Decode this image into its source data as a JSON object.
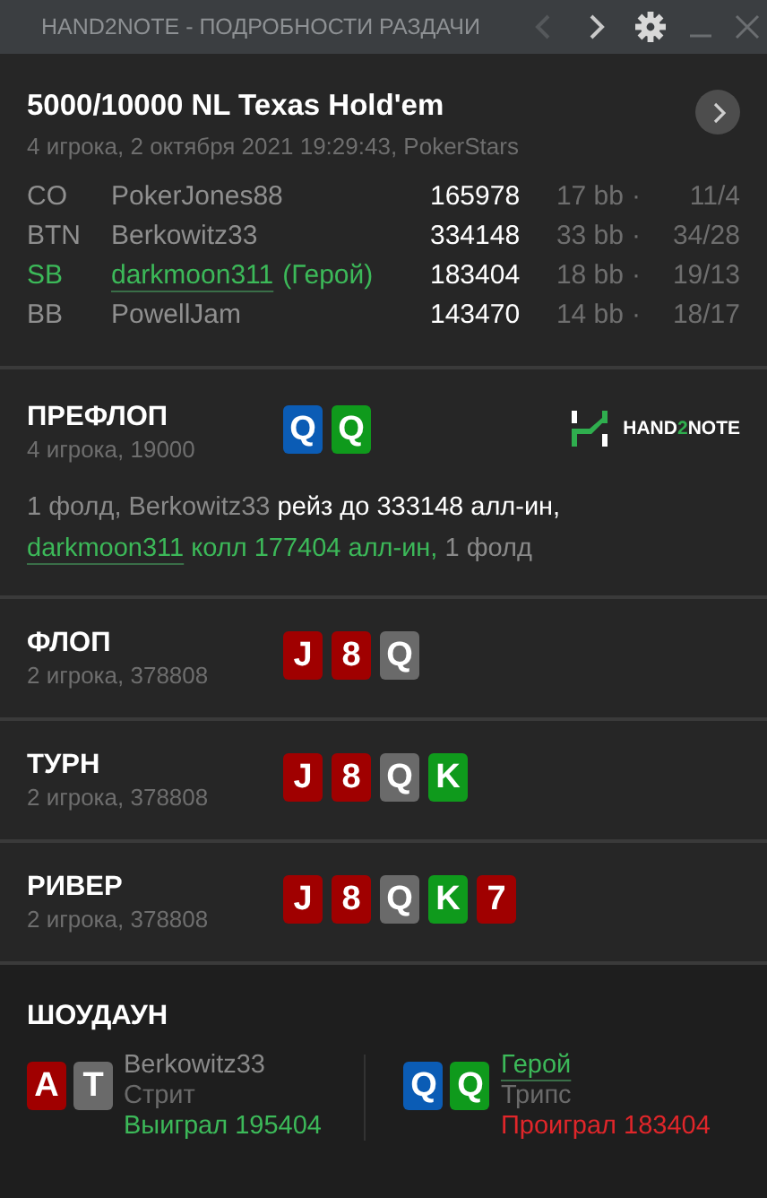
{
  "window": {
    "title": "HAND2NOTE - ПОДРОБНОСТИ РАЗДАЧИ",
    "nav": [
      {
        "kind": "prev",
        "disabled": true
      },
      {
        "kind": "next",
        "disabled": false
      }
    ]
  },
  "hand": {
    "title": "5000/10000 NL Texas Hold'em",
    "subtitle": "4 игрока, 2 октября 2021 19:29:43, PokerStars"
  },
  "players": [
    {
      "position": "CO",
      "name": "PokerJones88",
      "hero": false,
      "stack": "165978",
      "bb": "17 bb",
      "sep": "·",
      "stats": "11/4"
    },
    {
      "position": "BTN",
      "name": "Berkowitz33",
      "hero": false,
      "stack": "334148",
      "bb": "33 bb",
      "sep": "·",
      "stats": "34/28"
    },
    {
      "position": "SB",
      "name": "darkmoon311",
      "hero_tag": "(Герой)",
      "hero": true,
      "stack": "183404",
      "bb": "18 bb",
      "sep": "·",
      "stats": "19/13"
    },
    {
      "position": "BB",
      "name": "PowellJam",
      "hero": false,
      "stack": "143470",
      "bb": "14 bb",
      "sep": "·",
      "stats": "18/17"
    }
  ],
  "streets": [
    {
      "name": "ПРЕФЛОП",
      "info": "4 игрока, 19000",
      "cards": [
        {
          "rank": "Q",
          "color": "#0b5cb5"
        },
        {
          "rank": "Q",
          "color": "#0f9a1c"
        }
      ],
      "logo": [
        "HAND",
        "2",
        "NOTE"
      ],
      "action": [
        {
          "text": "1 фолд, Berkowitz33 ",
          "color": "#8a8a8a"
        },
        {
          "text": "рейз до 333148 алл-ин, ",
          "color": "#ffffff"
        },
        {
          "text": "darkmoon311",
          "color": "#3cb959",
          "link": true
        },
        {
          "text": " колл 177404 алл-ин,",
          "color": "#3cb959"
        },
        {
          "text": " 1 фолд",
          "color": "#8a8a8a"
        }
      ]
    },
    {
      "name": "ФЛОП",
      "info": "2 игрока, 378808",
      "cards": [
        {
          "rank": "J",
          "color": "#a00000"
        },
        {
          "rank": "8",
          "color": "#a00000"
        },
        {
          "rank": "Q",
          "color": "#6a6a6a"
        }
      ]
    },
    {
      "name": "ТУРН",
      "info": "2 игрока, 378808",
      "cards": [
        {
          "rank": "J",
          "color": "#a00000"
        },
        {
          "rank": "8",
          "color": "#a00000"
        },
        {
          "rank": "Q",
          "color": "#6a6a6a"
        },
        {
          "rank": "K",
          "color": "#0f9a1c"
        }
      ]
    },
    {
      "name": "РИВЕР",
      "info": "2 игрока, 378808",
      "cards": [
        {
          "rank": "J",
          "color": "#a00000"
        },
        {
          "rank": "8",
          "color": "#a00000"
        },
        {
          "rank": "Q",
          "color": "#6a6a6a"
        },
        {
          "rank": "K",
          "color": "#0f9a1c"
        },
        {
          "rank": "7",
          "color": "#a00000"
        }
      ]
    }
  ],
  "showdown": {
    "title": "ШОУДАУН",
    "players": [
      {
        "name": "Berkowitz33",
        "hero": false,
        "hand": "Стрит",
        "result": "Выиграл 195404",
        "won": true,
        "cards": [
          {
            "rank": "A",
            "color": "#a00000"
          },
          {
            "rank": "T",
            "color": "#6a6a6a"
          }
        ]
      },
      {
        "name": "Герой",
        "hero": true,
        "hand": "Трипс",
        "result": "Проиграл 183404",
        "won": false,
        "cards": [
          {
            "rank": "Q",
            "color": "#0b5cb5"
          },
          {
            "rank": "Q",
            "color": "#0f9a1c"
          }
        ]
      }
    ]
  }
}
